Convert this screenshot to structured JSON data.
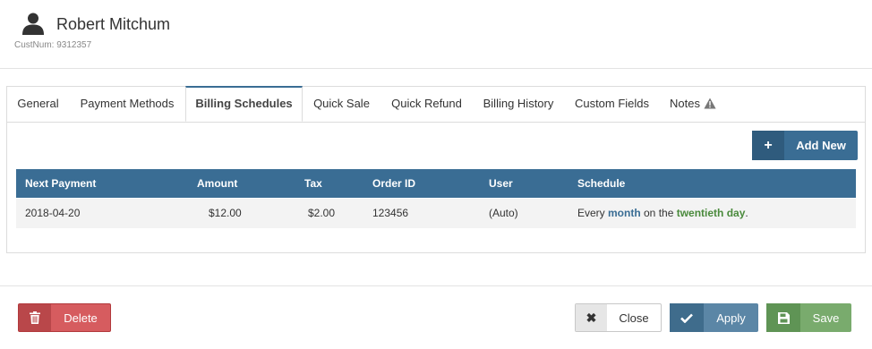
{
  "customer": {
    "name": "Robert Mitchum",
    "cust_num": "CustNum: 9312357"
  },
  "tabs": [
    {
      "label": "General"
    },
    {
      "label": "Payment Methods"
    },
    {
      "label": "Billing Schedules",
      "active": true
    },
    {
      "label": "Quick Sale"
    },
    {
      "label": "Quick Refund"
    },
    {
      "label": "Billing History"
    },
    {
      "label": "Custom Fields"
    },
    {
      "label": "Notes",
      "icon": "warning-icon"
    }
  ],
  "add_button": {
    "label": "Add New",
    "icon": "plus-icon"
  },
  "table": {
    "columns": [
      "Next Payment",
      "Amount",
      "Tax",
      "Order ID",
      "User",
      "Schedule"
    ],
    "rows": [
      {
        "next_payment": "2018-04-20",
        "amount": "$12.00",
        "tax": "$2.00",
        "order_id": "123456",
        "user": "(Auto)",
        "schedule": {
          "prefix": "Every ",
          "period": "month",
          "middle": " on the ",
          "day": "twentieth day",
          "suffix": "."
        }
      }
    ]
  },
  "footer": {
    "delete": {
      "label": "Delete",
      "icon": "trash-icon"
    },
    "close": {
      "label": "Close",
      "icon": "close-icon"
    },
    "apply": {
      "label": "Apply",
      "icon": "check-icon"
    },
    "save": {
      "label": "Save",
      "icon": "save-icon"
    }
  },
  "colors": {
    "primary": "#3a6d94",
    "danger": "#d65c5f",
    "success": "#79ab6d",
    "schedule_green": "#4a8a3c"
  }
}
